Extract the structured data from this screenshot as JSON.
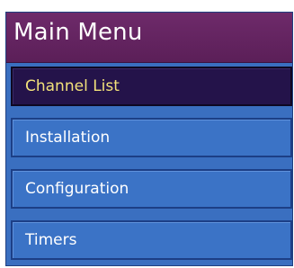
{
  "menu": {
    "title": "Main Menu",
    "selected_index": 0,
    "items": [
      {
        "label": "Channel List"
      },
      {
        "label": "Installation"
      },
      {
        "label": "Configuration"
      },
      {
        "label": "Timers"
      }
    ]
  },
  "colors": {
    "header_background": "#5b1f58",
    "panel_background": "#3a6fc0",
    "item_background": "#3b73c6",
    "selected_background": "#24134a",
    "selected_text": "#f3e27a",
    "text": "#ffffff"
  }
}
